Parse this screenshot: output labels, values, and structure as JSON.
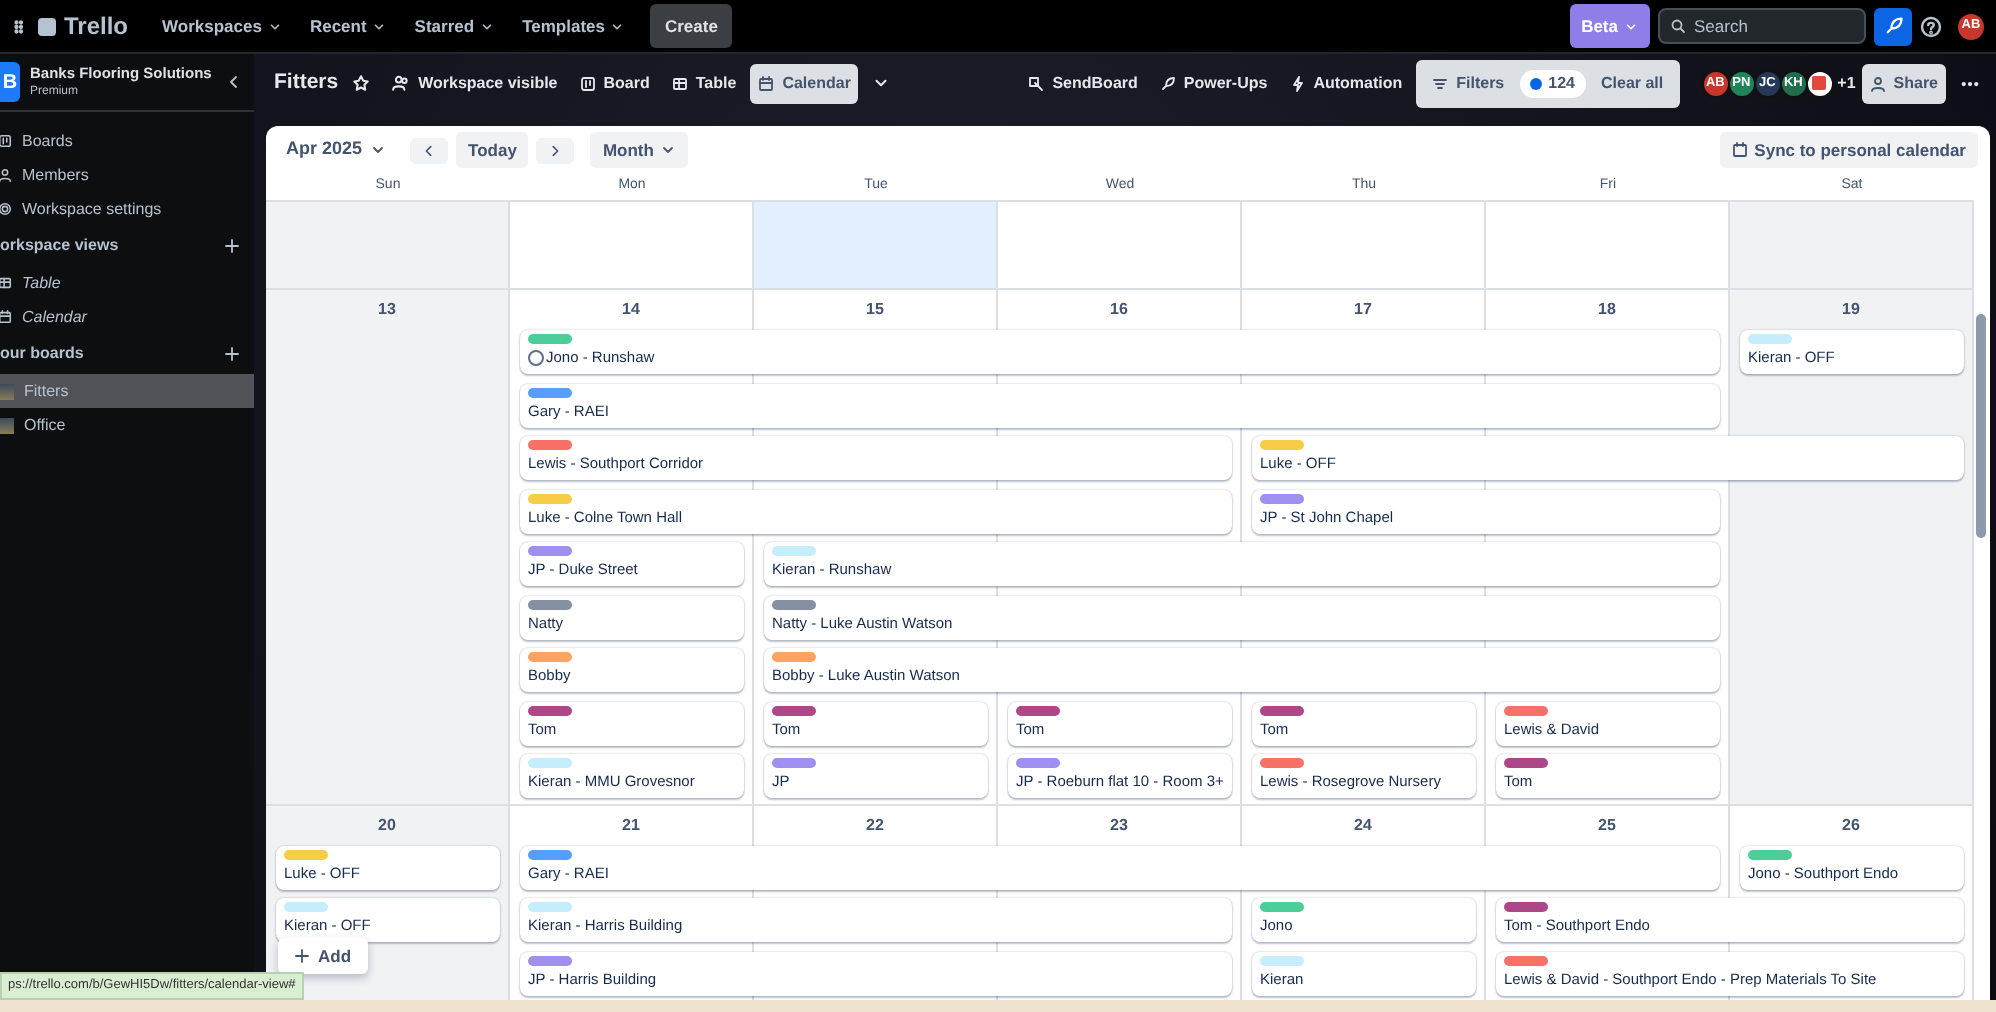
{
  "topnav": {
    "logo": "Trello",
    "menus": [
      "Workspaces",
      "Recent",
      "Starred",
      "Templates"
    ],
    "create": "Create",
    "beta": "Beta",
    "search": {
      "placeholder": "Search"
    },
    "avatar": "AB"
  },
  "sidebar": {
    "workspace": {
      "initial": "B",
      "name": "Banks Flooring Solutions",
      "plan": "Premium"
    },
    "items": [
      {
        "label": "Boards"
      },
      {
        "label": "Members"
      },
      {
        "label": "Workspace settings"
      }
    ],
    "views_heading": "orkspace views",
    "views": [
      {
        "label": "Table"
      },
      {
        "label": "Calendar"
      }
    ],
    "boards_heading": "our boards",
    "boards": [
      {
        "label": "Fitters",
        "selected": true
      },
      {
        "label": "Office",
        "selected": false
      }
    ]
  },
  "board_header": {
    "title": "Fitters",
    "visibility": "Workspace visible",
    "views": [
      {
        "label": "Board",
        "selected": false
      },
      {
        "label": "Table",
        "selected": false
      },
      {
        "label": "Calendar",
        "selected": true
      }
    ],
    "actions": [
      {
        "label": "SendBoard"
      },
      {
        "label": "Power-Ups"
      },
      {
        "label": "Automation"
      }
    ],
    "filters": {
      "label": "Filters",
      "count": "124",
      "clear": "Clear all"
    },
    "members": [
      {
        "kind": "initials",
        "initials": "AB",
        "color": "#c9372c"
      },
      {
        "kind": "initials",
        "initials": "PN",
        "color": "#1f845a"
      },
      {
        "kind": "initials",
        "initials": "JC",
        "color": "#253858"
      },
      {
        "kind": "initials",
        "initials": "KH",
        "color": "#216e4e"
      },
      {
        "kind": "logo",
        "color": "#ffffff"
      }
    ],
    "more_members": "+1",
    "share": "Share"
  },
  "calendar": {
    "month": "Apr 2025",
    "today": "Today",
    "range": "Month",
    "sync": "Sync to personal calendar",
    "weekdays": [
      "Sun",
      "Mon",
      "Tue",
      "Wed",
      "Thu",
      "Fri",
      "Sat"
    ],
    "weeks": [
      {
        "days": [
          {
            "kind": "weekend"
          },
          {
            "kind": "weekday"
          },
          {
            "kind": "highlighted"
          },
          {
            "kind": "weekday"
          },
          {
            "kind": "weekday"
          },
          {
            "kind": "weekday"
          },
          {
            "kind": "weekend"
          }
        ]
      },
      {
        "days": [
          {
            "number": "13",
            "kind": "weekend"
          },
          {
            "number": "14",
            "kind": "weekday"
          },
          {
            "number": "15",
            "kind": "weekday"
          },
          {
            "number": "16",
            "kind": "weekday"
          },
          {
            "number": "17",
            "kind": "weekday"
          },
          {
            "number": "18",
            "kind": "weekday"
          },
          {
            "number": "19",
            "kind": "weekend"
          }
        ],
        "rows": [
          [
            "",
            {
              "title": "Jono - Runshaw",
              "color": "#4bce97",
              "completed": false
            },
            null,
            null,
            null,
            null,
            {
              "title": "Kieran - OFF",
              "color": "#c6edfb"
            }
          ],
          [
            "",
            {
              "title": "Gary - RAEI",
              "color": "#579dff"
            },
            null,
            null,
            null,
            null,
            ""
          ],
          [
            "",
            {
              "title": "Lewis - Southport Corridor",
              "color": "#f87168"
            },
            null,
            null,
            {
              "title": "Luke - OFF",
              "color": "#f5cd47"
            },
            null,
            null
          ],
          [
            "",
            {
              "title": "Luke - Colne Town Hall",
              "color": "#f5cd47"
            },
            null,
            null,
            {
              "title": "JP - St John Chapel",
              "color": "#9f8fef"
            },
            null,
            ""
          ],
          [
            "",
            {
              "title": "JP - Duke Street",
              "color": "#9f8fef"
            },
            {
              "title": "Kieran - Runshaw",
              "color": "#c6edfb"
            },
            null,
            null,
            null,
            ""
          ],
          [
            "",
            {
              "title": "Natty",
              "color": "#8590a2"
            },
            {
              "title": "Natty - Luke Austin Watson",
              "color": "#8590a2"
            },
            null,
            null,
            null,
            ""
          ],
          [
            "",
            {
              "title": "Bobby",
              "color": "#fea362"
            },
            {
              "title": "Bobby - Luke Austin Watson",
              "color": "#fea362"
            },
            null,
            null,
            null,
            ""
          ],
          [
            "",
            {
              "title": "Tom",
              "color": "#ae4787"
            },
            {
              "title": "Tom",
              "color": "#ae4787"
            },
            {
              "title": "Tom",
              "color": "#ae4787"
            },
            {
              "title": "Tom",
              "color": "#ae4787"
            },
            {
              "title": "Lewis & David",
              "color": "#f87168"
            },
            ""
          ],
          [
            "",
            {
              "title": "Kieran - MMU Grovesnor",
              "color": "#c6edfb"
            },
            {
              "title": "JP",
              "color": "#9f8fef"
            },
            {
              "title": "JP - Roeburn flat 10 - Room 3+",
              "color": "#9f8fef"
            },
            {
              "title": "Lewis - Rosegrove Nursery",
              "color": "#f87168"
            },
            {
              "title": "Tom",
              "color": "#ae4787"
            },
            ""
          ]
        ]
      },
      {
        "days": [
          {
            "number": "20",
            "kind": "weekend"
          },
          {
            "number": "21",
            "kind": "weekday"
          },
          {
            "number": "22",
            "kind": "weekday"
          },
          {
            "number": "23",
            "kind": "weekday"
          },
          {
            "number": "24",
            "kind": "weekday"
          },
          {
            "number": "25",
            "kind": "weekday"
          },
          {
            "number": "26",
            "kind": "weekday"
          }
        ],
        "add": "Add",
        "rows": [
          [
            {
              "title": "Luke - OFF",
              "color": "#f5cd47"
            },
            {
              "title": "Gary - RAEI",
              "color": "#579dff"
            },
            null,
            null,
            null,
            null,
            {
              "title": "Jono - Southport Endo",
              "color": "#4bce97"
            }
          ],
          [
            {
              "title": "Kieran - OFF",
              "color": "#c6edfb"
            },
            {
              "title": "Kieran - Harris Building",
              "color": "#c6edfb"
            },
            null,
            null,
            {
              "title": "Jono",
              "color": "#4bce97"
            },
            {
              "title": "Tom - Southport Endo",
              "color": "#ae4787"
            },
            null
          ],
          [
            "",
            {
              "title": "JP - Harris Building",
              "color": "#9f8fef"
            },
            null,
            null,
            {
              "title": "Kieran",
              "color": "#c6edfb"
            },
            {
              "title": "Lewis & David - Southport Endo - Prep Materials To Site",
              "color": "#f87168"
            },
            null
          ]
        ]
      }
    ]
  },
  "status_bar": "ps://trello.com/b/GewHI5Dw/fitters/calendar-view#"
}
